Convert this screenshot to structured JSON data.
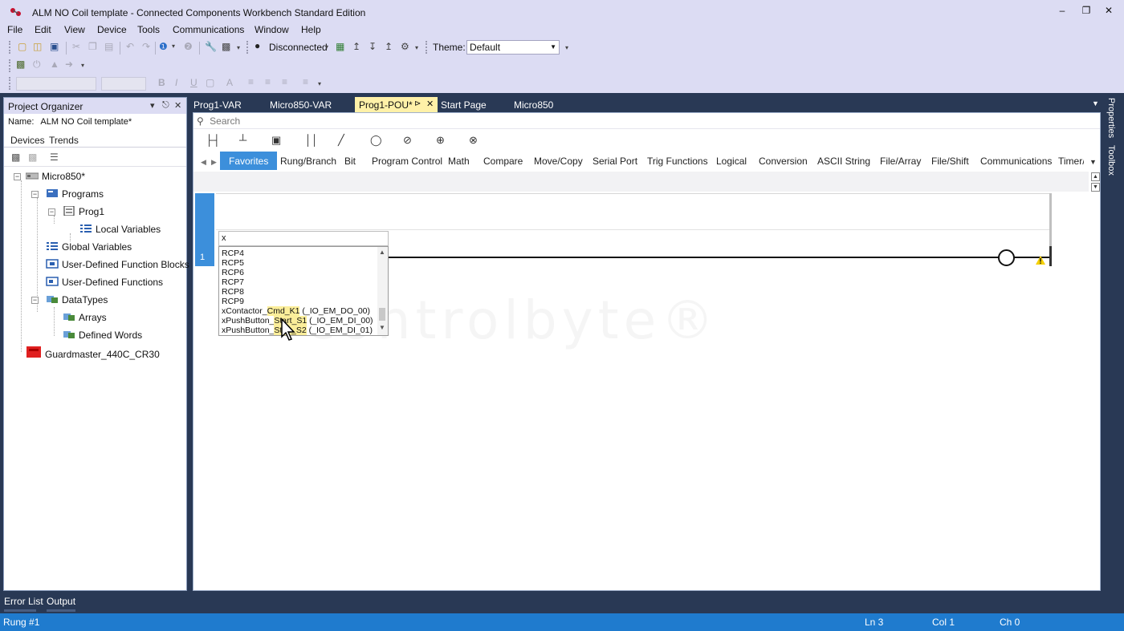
{
  "window": {
    "title": "ALM NO Coil template - Connected Components Workbench Standard Edition",
    "minimize": "–",
    "restore": "❐",
    "close": "✕"
  },
  "menu": [
    "File",
    "Edit",
    "View",
    "Device",
    "Tools",
    "Communications",
    "Window",
    "Help"
  ],
  "toolbar": {
    "connection_status": "Disconnected",
    "theme_label": "Theme:",
    "theme_value": "Default"
  },
  "organizer": {
    "title": "Project Organizer",
    "name_label": "Name:",
    "name_value": "ALM NO Coil template*",
    "tabs": [
      "Devices",
      "Trends"
    ],
    "tree": {
      "root": "Micro850*",
      "programs": "Programs",
      "prog1": "Prog1",
      "local_variables": "Local Variables",
      "global_variables": "Global Variables",
      "udfb": "User-Defined Function Blocks",
      "udf": "User-Defined Functions",
      "datatypes": "DataTypes",
      "arrays": "Arrays",
      "defined_words": "Defined Words",
      "guardmaster": "Guardmaster_440C_CR30"
    }
  },
  "doc_tabs": [
    "Prog1-VAR",
    "Micro850-VAR",
    "Prog1-POU*",
    "Start Page",
    "Micro850"
  ],
  "editor": {
    "search_placeholder": "Search",
    "instruction_tabs": [
      "Favorites",
      "Rung/Branch",
      "Bit",
      "Program Control",
      "Math",
      "Compare",
      "Move/Copy",
      "Serial Port",
      "Trig Functions",
      "Logical",
      "Conversion",
      "ASCII String",
      "File/Array",
      "File/Shift",
      "Communications",
      "Timer/C"
    ],
    "rung_number": "1",
    "autocomplete": {
      "input": "x",
      "items": [
        "RCP4",
        "RCP5",
        "RCP6",
        "RCP7",
        "RCP8",
        "RCP9"
      ],
      "contactor": {
        "a": "xContactor_",
        "b": "Cmd_K1",
        "c": " (_IO_EM_DO_00)"
      },
      "pb_start": {
        "a": "xPushButton_",
        "b": "Start_S1",
        "c": " (_IO_EM_DI_00)"
      },
      "pb_stop": {
        "a": "xPushButton_",
        "b": "Stop_S2",
        "c": " (_IO_EM_DI_01)"
      }
    },
    "watermark": "controlbyte®"
  },
  "side_panel": [
    "Properties",
    "Toolbox"
  ],
  "bottom_tabs": [
    "Error List",
    "Output"
  ],
  "status": {
    "rung": "Rung #1",
    "line": "Ln 3",
    "col": "Col 1",
    "ch": "Ch 0"
  },
  "colors": {
    "accent": "#3c8fdb",
    "status_bar": "#1f7bce",
    "chrome": "#dcdcf3",
    "dark_frame": "#293955",
    "active_tab": "#fff1a8"
  }
}
